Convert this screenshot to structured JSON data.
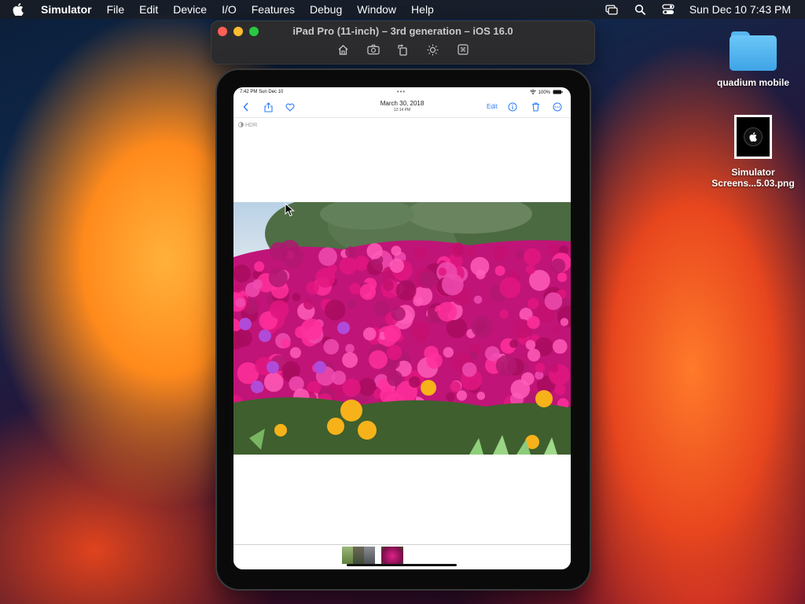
{
  "menubar": {
    "items": [
      "Simulator",
      "File",
      "Edit",
      "Device",
      "I/O",
      "Features",
      "Debug",
      "Window",
      "Help"
    ],
    "clock": "Sun Dec 10  7:43 PM",
    "icons": [
      "apple-icon",
      "screen-mirroring-icon",
      "search-icon",
      "control-center-icon"
    ]
  },
  "simulator_window": {
    "title": "iPad Pro (11-inch) – 3rd generation – iOS 16.0",
    "toolbar_icons": [
      "home-icon",
      "screenshot-icon",
      "rotate-icon",
      "appearance-icon",
      "keyboard-shortcut-icon"
    ],
    "traffic_lights": {
      "close": "#ff5f57",
      "minimize": "#febc2e",
      "zoom": "#28c840"
    }
  },
  "desktop": {
    "folder_label": "quadium mobile",
    "file_label": "Simulator Screens...5.03.png"
  },
  "ipad": {
    "status": {
      "time": "7:42 PM  Sun Dec 10",
      "dots": "•••",
      "battery": "100%"
    },
    "nav": {
      "date": "March 30, 2018",
      "time": "12:14 PM",
      "edit": "Edit",
      "icons": [
        "back-chevron-icon",
        "share-icon",
        "heart-icon",
        "info-icon",
        "trash-icon",
        "more-icon"
      ]
    },
    "hdr_badge": "HDR",
    "photo_subject": "flowers"
  },
  "colors": {
    "accent": "#2f7cf6",
    "ipad_frame": "#0a0a0a"
  }
}
